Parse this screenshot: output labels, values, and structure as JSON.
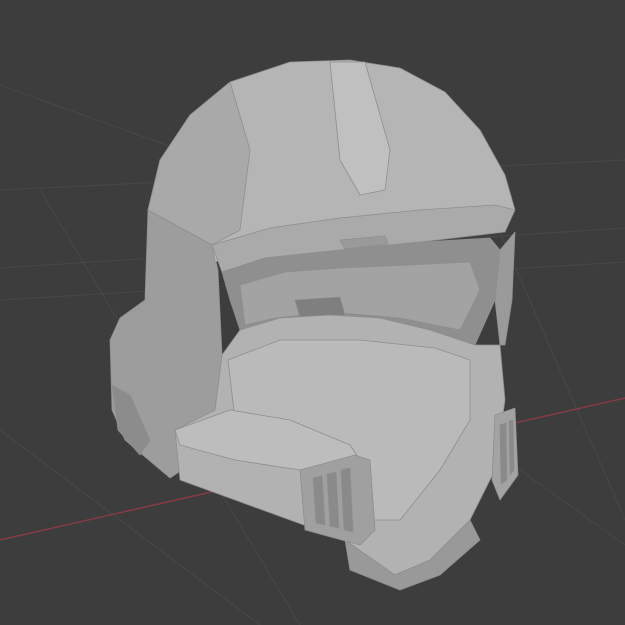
{
  "viewport": {
    "background": "#3d3d3d",
    "grid_line_color": "#4a4a4a",
    "x_axis_color": "#8a3b45",
    "model_base_color": "#a6a6a6",
    "model_highlight_color": "#bdbdbd",
    "model_shadow_color": "#7e7e7e",
    "visor_color": "#959595"
  }
}
